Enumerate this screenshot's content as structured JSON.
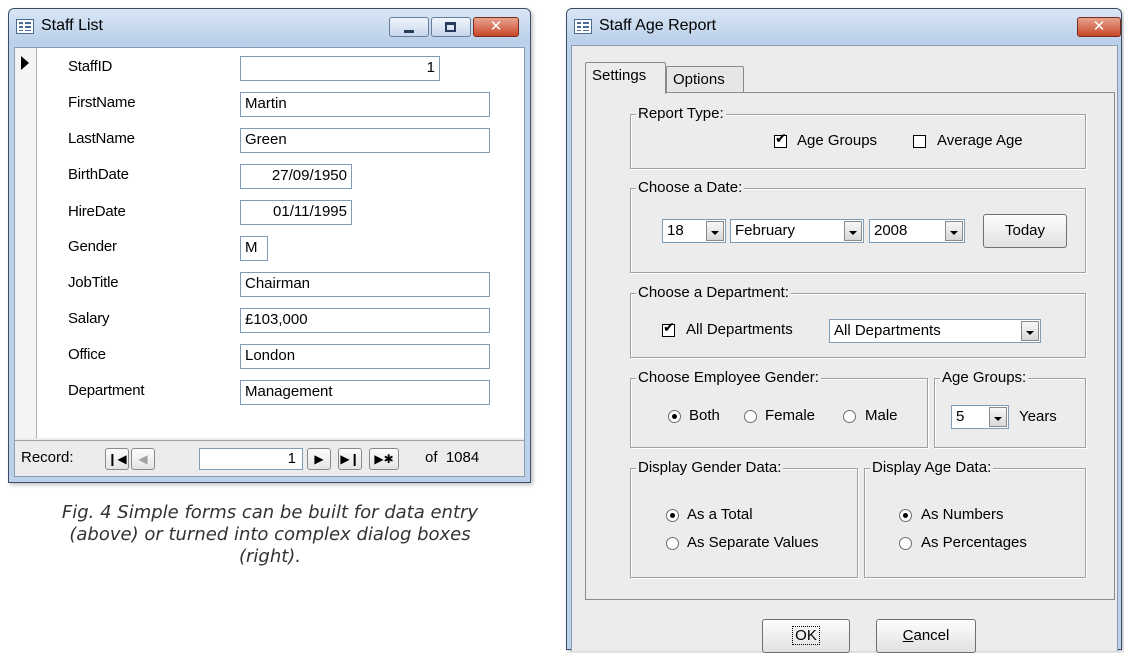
{
  "staff_list": {
    "title": "Staff List",
    "fields": [
      {
        "label": "StaffID",
        "value": "1"
      },
      {
        "label": "FirstName",
        "value": "Martin"
      },
      {
        "label": "LastName",
        "value": "Green"
      },
      {
        "label": "BirthDate",
        "value": "27/09/1950"
      },
      {
        "label": "HireDate",
        "value": "01/11/1995"
      },
      {
        "label": "Gender",
        "value": "M"
      },
      {
        "label": "JobTitle",
        "value": "Chairman"
      },
      {
        "label": "Salary",
        "value": "£103,000"
      },
      {
        "label": "Office",
        "value": "London"
      },
      {
        "label": "Department",
        "value": "Management"
      }
    ],
    "nav": {
      "label": "Record:",
      "current": "1",
      "of_text": "of  1084",
      "icons": [
        "first-record-icon",
        "previous-record-icon",
        "next-record-icon",
        "last-record-icon",
        "new-record-icon"
      ]
    }
  },
  "caption": {
    "line1": "Fig. 4 Simple forms can be built for data entry",
    "line2": "(above) or turned into complex dialog boxes",
    "line3": "(right)."
  },
  "report": {
    "title": "Staff Age Report",
    "tabs": [
      "Settings",
      "Options"
    ],
    "active_tab": "Settings",
    "report_type": {
      "title": "Report Type:",
      "age_groups": {
        "label": "Age Groups",
        "checked": true
      },
      "average_age": {
        "label": "Average Age",
        "checked": false
      }
    },
    "date": {
      "title": "Choose a Date:",
      "day": "18",
      "month": "February",
      "year": "2008",
      "today_label": "Today"
    },
    "department": {
      "title": "Choose a Department:",
      "all_label": "All Departments",
      "all_checked": true,
      "selected": "All Departments"
    },
    "gender": {
      "title": "Choose Employee Gender:",
      "options": [
        "Both",
        "Female",
        "Male"
      ],
      "selected": "Both"
    },
    "age_groups": {
      "title": "Age Groups:",
      "value": "5",
      "unit": "Years"
    },
    "gender_data": {
      "title": "Display Gender Data:",
      "options": [
        "As a Total",
        "As Separate Values"
      ],
      "selected": "As a Total"
    },
    "age_data": {
      "title": "Display Age Data:",
      "options": [
        "As Numbers",
        "As Percentages"
      ],
      "selected": "As Numbers"
    },
    "ok_label": "OK",
    "cancel_label": "Cancel"
  },
  "colors": {
    "window_frame": "#bcd1ea",
    "dialog_face": "#ececec",
    "close_button": "#c8472a",
    "field_border": "#7f9db9"
  }
}
